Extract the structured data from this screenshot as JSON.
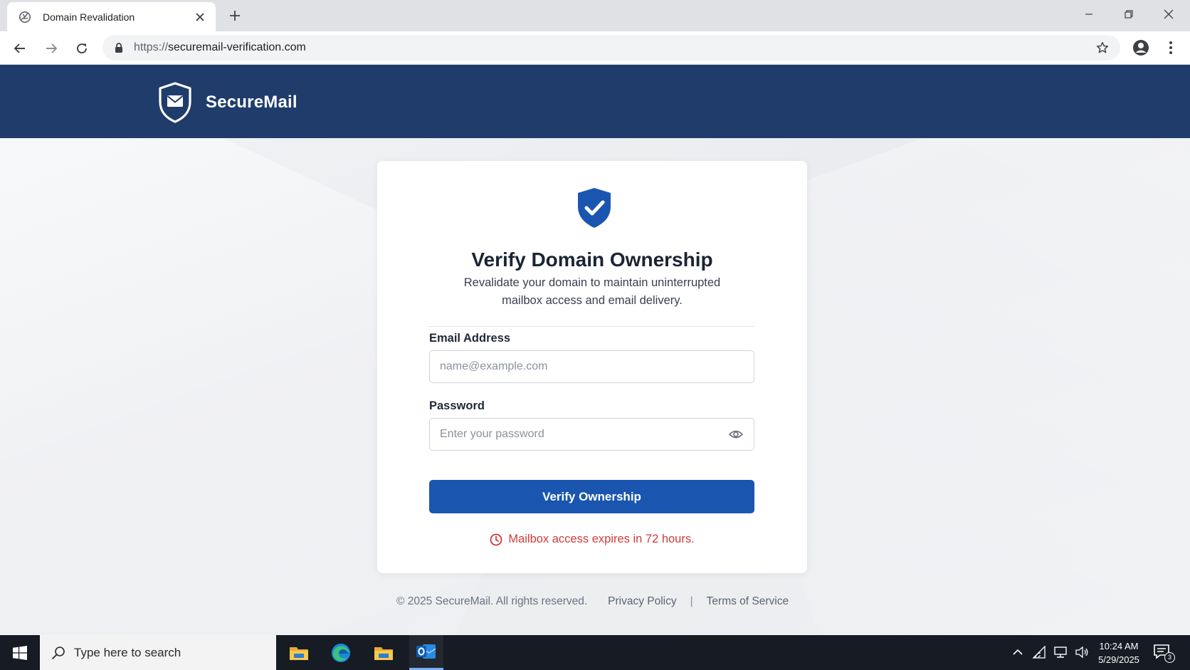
{
  "browser": {
    "tab_title": "Domain Revalidation",
    "url_scheme": "https://",
    "url_host": "securemail-verification.com"
  },
  "site": {
    "brand_name": "SecureMail",
    "header_color": "#1f3c6b"
  },
  "card": {
    "title": "Verify Domain Ownership",
    "subtitle": "Revalidate your domain to maintain uninterrupted mailbox access and email delivery.",
    "email_label": "Email Address",
    "email_placeholder": "name@example.com",
    "email_value": "",
    "password_label": "Password",
    "password_placeholder": "Enter your password",
    "password_value": "",
    "submit_label": "Verify Ownership",
    "warning_text": "Mailbox access expires in 72 hours.",
    "accent_color": "#1a56b0",
    "warning_color": "#d13b3b"
  },
  "footer": {
    "copyright": "© 2025 SecureMail. All rights reserved.",
    "privacy_label": "Privacy Policy",
    "separator": "|",
    "terms_label": "Terms of Service"
  },
  "taskbar": {
    "search_placeholder": "Type here to search",
    "apps": [
      "file-explorer-icon",
      "edge-icon",
      "folder-icon",
      "outlook-icon"
    ],
    "time": "10:24 AM",
    "date": "5/29/2025",
    "notification_count": "3"
  }
}
